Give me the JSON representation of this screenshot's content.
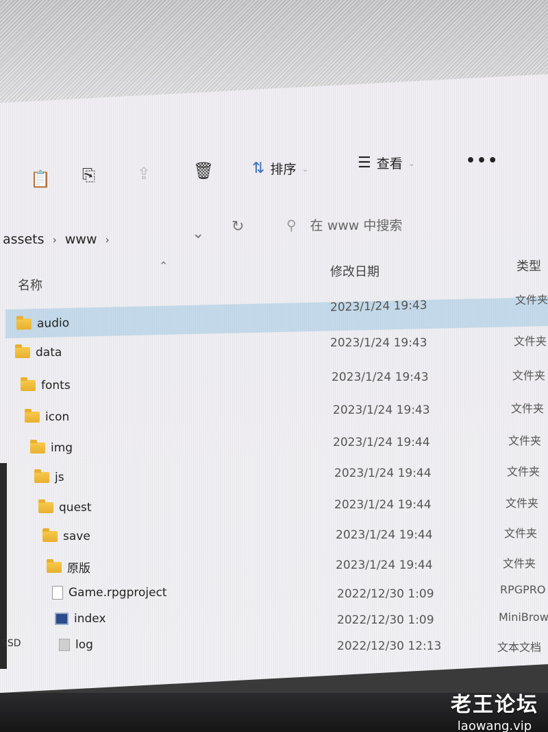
{
  "toolbar": {
    "sort_label": "排序",
    "view_label": "查看",
    "more_label": "•••"
  },
  "address": {
    "breadcrumb": [
      "assets",
      "www"
    ],
    "search_placeholder": "在 www 中搜索"
  },
  "columns": {
    "name": "名称",
    "modified": "修改日期",
    "type": "类型"
  },
  "files": [
    {
      "name": "audio",
      "date": "2023/1/24 19:43",
      "type": "文件夹",
      "kind": "folder",
      "selected": true
    },
    {
      "name": "data",
      "date": "2023/1/24 19:43",
      "type": "文件夹",
      "kind": "folder"
    },
    {
      "name": "fonts",
      "date": "2023/1/24 19:43",
      "type": "文件夹",
      "kind": "folder"
    },
    {
      "name": "icon",
      "date": "2023/1/24 19:43",
      "type": "文件夹",
      "kind": "folder"
    },
    {
      "name": "img",
      "date": "2023/1/24 19:44",
      "type": "文件夹",
      "kind": "folder"
    },
    {
      "name": "js",
      "date": "2023/1/24 19:44",
      "type": "文件夹",
      "kind": "folder"
    },
    {
      "name": "quest",
      "date": "2023/1/24 19:44",
      "type": "文件夹",
      "kind": "folder"
    },
    {
      "name": "save",
      "date": "2023/1/24 19:44",
      "type": "文件夹",
      "kind": "folder"
    },
    {
      "name": "原版",
      "date": "2023/1/24 19:44",
      "type": "文件夹",
      "kind": "folder"
    },
    {
      "name": "Game.rpgproject",
      "date": "2022/12/30 1:09",
      "type": "RPGPRO",
      "kind": "file"
    },
    {
      "name": "index",
      "date": "2022/12/30 1:09",
      "type": "MiniBrow",
      "kind": "html"
    },
    {
      "name": "log",
      "date": "2022/12/30 12:13",
      "type": "文本文档",
      "kind": "txt"
    }
  ],
  "sidebar": {
    "drive_label": "SSD"
  },
  "watermark": {
    "title": "老王论坛",
    "url": "laowang.vip"
  },
  "icons": {
    "toolbar": [
      "paste-icon",
      "rename-icon",
      "share-icon",
      "delete-icon",
      "sort-icon",
      "view-icon"
    ],
    "address": [
      "chevron-down-icon",
      "refresh-icon",
      "search-icon"
    ]
  }
}
